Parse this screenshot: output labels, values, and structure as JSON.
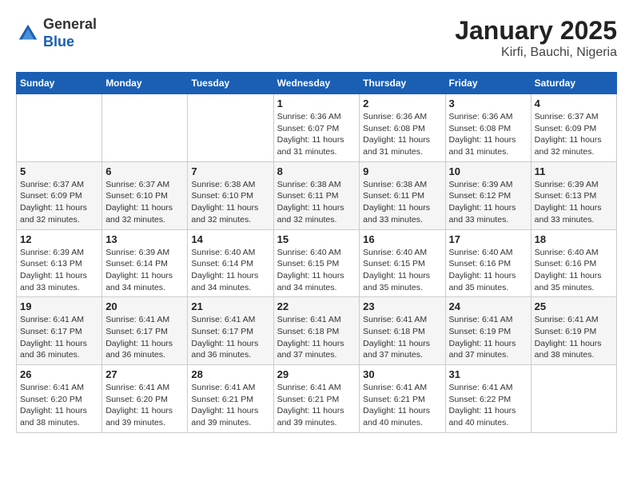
{
  "header": {
    "logo_line1": "General",
    "logo_line2": "Blue",
    "title": "January 2025",
    "subtitle": "Kirfi, Bauchi, Nigeria"
  },
  "calendar": {
    "days_of_week": [
      "Sunday",
      "Monday",
      "Tuesday",
      "Wednesday",
      "Thursday",
      "Friday",
      "Saturday"
    ],
    "weeks": [
      [
        {
          "day": "",
          "sunrise": "",
          "sunset": "",
          "daylight": ""
        },
        {
          "day": "",
          "sunrise": "",
          "sunset": "",
          "daylight": ""
        },
        {
          "day": "",
          "sunrise": "",
          "sunset": "",
          "daylight": ""
        },
        {
          "day": "1",
          "sunrise": "Sunrise: 6:36 AM",
          "sunset": "Sunset: 6:07 PM",
          "daylight": "Daylight: 11 hours and 31 minutes."
        },
        {
          "day": "2",
          "sunrise": "Sunrise: 6:36 AM",
          "sunset": "Sunset: 6:08 PM",
          "daylight": "Daylight: 11 hours and 31 minutes."
        },
        {
          "day": "3",
          "sunrise": "Sunrise: 6:36 AM",
          "sunset": "Sunset: 6:08 PM",
          "daylight": "Daylight: 11 hours and 31 minutes."
        },
        {
          "day": "4",
          "sunrise": "Sunrise: 6:37 AM",
          "sunset": "Sunset: 6:09 PM",
          "daylight": "Daylight: 11 hours and 32 minutes."
        }
      ],
      [
        {
          "day": "5",
          "sunrise": "Sunrise: 6:37 AM",
          "sunset": "Sunset: 6:09 PM",
          "daylight": "Daylight: 11 hours and 32 minutes."
        },
        {
          "day": "6",
          "sunrise": "Sunrise: 6:37 AM",
          "sunset": "Sunset: 6:10 PM",
          "daylight": "Daylight: 11 hours and 32 minutes."
        },
        {
          "day": "7",
          "sunrise": "Sunrise: 6:38 AM",
          "sunset": "Sunset: 6:10 PM",
          "daylight": "Daylight: 11 hours and 32 minutes."
        },
        {
          "day": "8",
          "sunrise": "Sunrise: 6:38 AM",
          "sunset": "Sunset: 6:11 PM",
          "daylight": "Daylight: 11 hours and 32 minutes."
        },
        {
          "day": "9",
          "sunrise": "Sunrise: 6:38 AM",
          "sunset": "Sunset: 6:11 PM",
          "daylight": "Daylight: 11 hours and 33 minutes."
        },
        {
          "day": "10",
          "sunrise": "Sunrise: 6:39 AM",
          "sunset": "Sunset: 6:12 PM",
          "daylight": "Daylight: 11 hours and 33 minutes."
        },
        {
          "day": "11",
          "sunrise": "Sunrise: 6:39 AM",
          "sunset": "Sunset: 6:13 PM",
          "daylight": "Daylight: 11 hours and 33 minutes."
        }
      ],
      [
        {
          "day": "12",
          "sunrise": "Sunrise: 6:39 AM",
          "sunset": "Sunset: 6:13 PM",
          "daylight": "Daylight: 11 hours and 33 minutes."
        },
        {
          "day": "13",
          "sunrise": "Sunrise: 6:39 AM",
          "sunset": "Sunset: 6:14 PM",
          "daylight": "Daylight: 11 hours and 34 minutes."
        },
        {
          "day": "14",
          "sunrise": "Sunrise: 6:40 AM",
          "sunset": "Sunset: 6:14 PM",
          "daylight": "Daylight: 11 hours and 34 minutes."
        },
        {
          "day": "15",
          "sunrise": "Sunrise: 6:40 AM",
          "sunset": "Sunset: 6:15 PM",
          "daylight": "Daylight: 11 hours and 34 minutes."
        },
        {
          "day": "16",
          "sunrise": "Sunrise: 6:40 AM",
          "sunset": "Sunset: 6:15 PM",
          "daylight": "Daylight: 11 hours and 35 minutes."
        },
        {
          "day": "17",
          "sunrise": "Sunrise: 6:40 AM",
          "sunset": "Sunset: 6:16 PM",
          "daylight": "Daylight: 11 hours and 35 minutes."
        },
        {
          "day": "18",
          "sunrise": "Sunrise: 6:40 AM",
          "sunset": "Sunset: 6:16 PM",
          "daylight": "Daylight: 11 hours and 35 minutes."
        }
      ],
      [
        {
          "day": "19",
          "sunrise": "Sunrise: 6:41 AM",
          "sunset": "Sunset: 6:17 PM",
          "daylight": "Daylight: 11 hours and 36 minutes."
        },
        {
          "day": "20",
          "sunrise": "Sunrise: 6:41 AM",
          "sunset": "Sunset: 6:17 PM",
          "daylight": "Daylight: 11 hours and 36 minutes."
        },
        {
          "day": "21",
          "sunrise": "Sunrise: 6:41 AM",
          "sunset": "Sunset: 6:17 PM",
          "daylight": "Daylight: 11 hours and 36 minutes."
        },
        {
          "day": "22",
          "sunrise": "Sunrise: 6:41 AM",
          "sunset": "Sunset: 6:18 PM",
          "daylight": "Daylight: 11 hours and 37 minutes."
        },
        {
          "day": "23",
          "sunrise": "Sunrise: 6:41 AM",
          "sunset": "Sunset: 6:18 PM",
          "daylight": "Daylight: 11 hours and 37 minutes."
        },
        {
          "day": "24",
          "sunrise": "Sunrise: 6:41 AM",
          "sunset": "Sunset: 6:19 PM",
          "daylight": "Daylight: 11 hours and 37 minutes."
        },
        {
          "day": "25",
          "sunrise": "Sunrise: 6:41 AM",
          "sunset": "Sunset: 6:19 PM",
          "daylight": "Daylight: 11 hours and 38 minutes."
        }
      ],
      [
        {
          "day": "26",
          "sunrise": "Sunrise: 6:41 AM",
          "sunset": "Sunset: 6:20 PM",
          "daylight": "Daylight: 11 hours and 38 minutes."
        },
        {
          "day": "27",
          "sunrise": "Sunrise: 6:41 AM",
          "sunset": "Sunset: 6:20 PM",
          "daylight": "Daylight: 11 hours and 39 minutes."
        },
        {
          "day": "28",
          "sunrise": "Sunrise: 6:41 AM",
          "sunset": "Sunset: 6:21 PM",
          "daylight": "Daylight: 11 hours and 39 minutes."
        },
        {
          "day": "29",
          "sunrise": "Sunrise: 6:41 AM",
          "sunset": "Sunset: 6:21 PM",
          "daylight": "Daylight: 11 hours and 39 minutes."
        },
        {
          "day": "30",
          "sunrise": "Sunrise: 6:41 AM",
          "sunset": "Sunset: 6:21 PM",
          "daylight": "Daylight: 11 hours and 40 minutes."
        },
        {
          "day": "31",
          "sunrise": "Sunrise: 6:41 AM",
          "sunset": "Sunset: 6:22 PM",
          "daylight": "Daylight: 11 hours and 40 minutes."
        },
        {
          "day": "",
          "sunrise": "",
          "sunset": "",
          "daylight": ""
        }
      ]
    ]
  }
}
